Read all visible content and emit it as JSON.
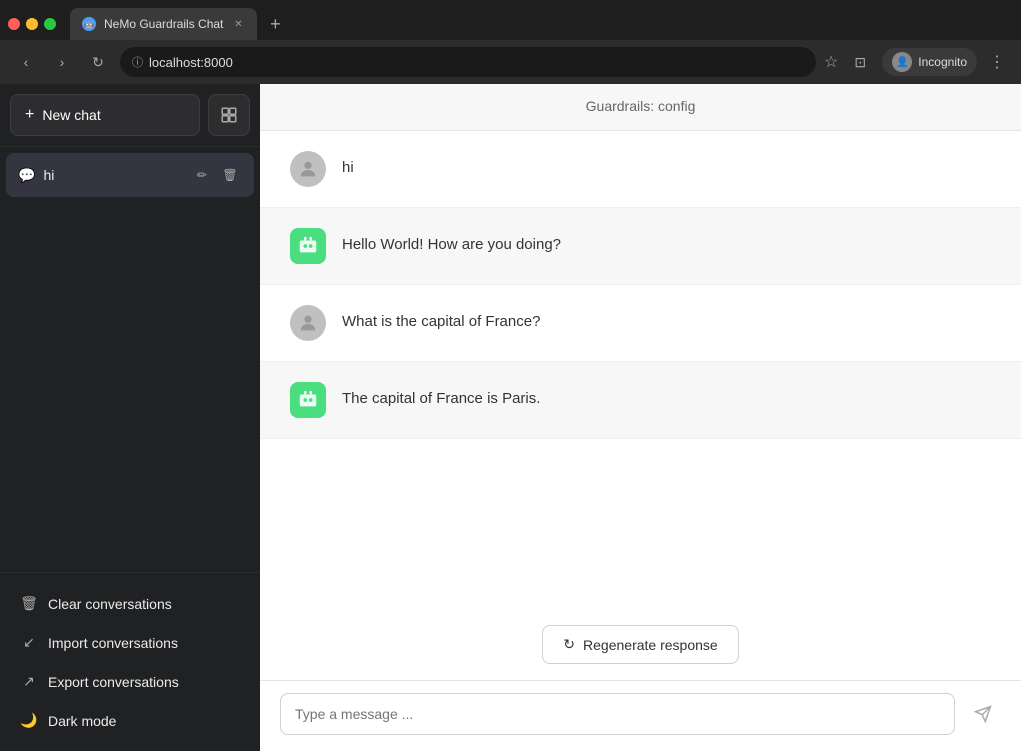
{
  "browser": {
    "tab_title": "NeMo Guardrails Chat",
    "url": "localhost:8000",
    "incognito_label": "Incognito"
  },
  "sidebar": {
    "new_chat_label": "New chat",
    "conversations": [
      {
        "id": "hi",
        "label": "hi"
      }
    ],
    "footer_items": [
      {
        "id": "clear",
        "icon": "🗑",
        "label": "Clear conversations"
      },
      {
        "id": "import",
        "icon": "↙",
        "label": "Import conversations"
      },
      {
        "id": "export",
        "icon": "↗",
        "label": "Export conversations"
      },
      {
        "id": "dark",
        "icon": "🌙",
        "label": "Dark mode"
      }
    ]
  },
  "chat": {
    "header_title": "Guardrails: config",
    "messages": [
      {
        "id": 1,
        "role": "user",
        "text": "hi"
      },
      {
        "id": 2,
        "role": "bot",
        "text": "Hello World! How are you doing?"
      },
      {
        "id": 3,
        "role": "user",
        "text": "What is the capital of France?"
      },
      {
        "id": 4,
        "role": "bot",
        "text": "The capital of France is Paris."
      }
    ],
    "regenerate_label": "Regenerate response",
    "input_placeholder": "Type a message ..."
  }
}
